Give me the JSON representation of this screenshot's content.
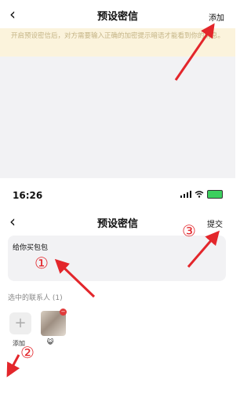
{
  "screen1": {
    "back_glyph": "‹",
    "title": "预设密信",
    "action_label": "添加",
    "notice": "开启预设密信后，对方需要输入正确的加密提示暗语才能看到你的消息。"
  },
  "status_bar": {
    "time": "16:26"
  },
  "screen2": {
    "back_glyph": "‹",
    "title": "预设密信",
    "submit_label": "提交",
    "message_text": "给你买包包",
    "selected_contacts_label": "选中的联系人 (1)",
    "add_label": "添加",
    "contact_emoji": "😺"
  },
  "annotations": {
    "step1": "①",
    "step2": "②",
    "step3": "③",
    "arrow_color": "#e3262b"
  }
}
